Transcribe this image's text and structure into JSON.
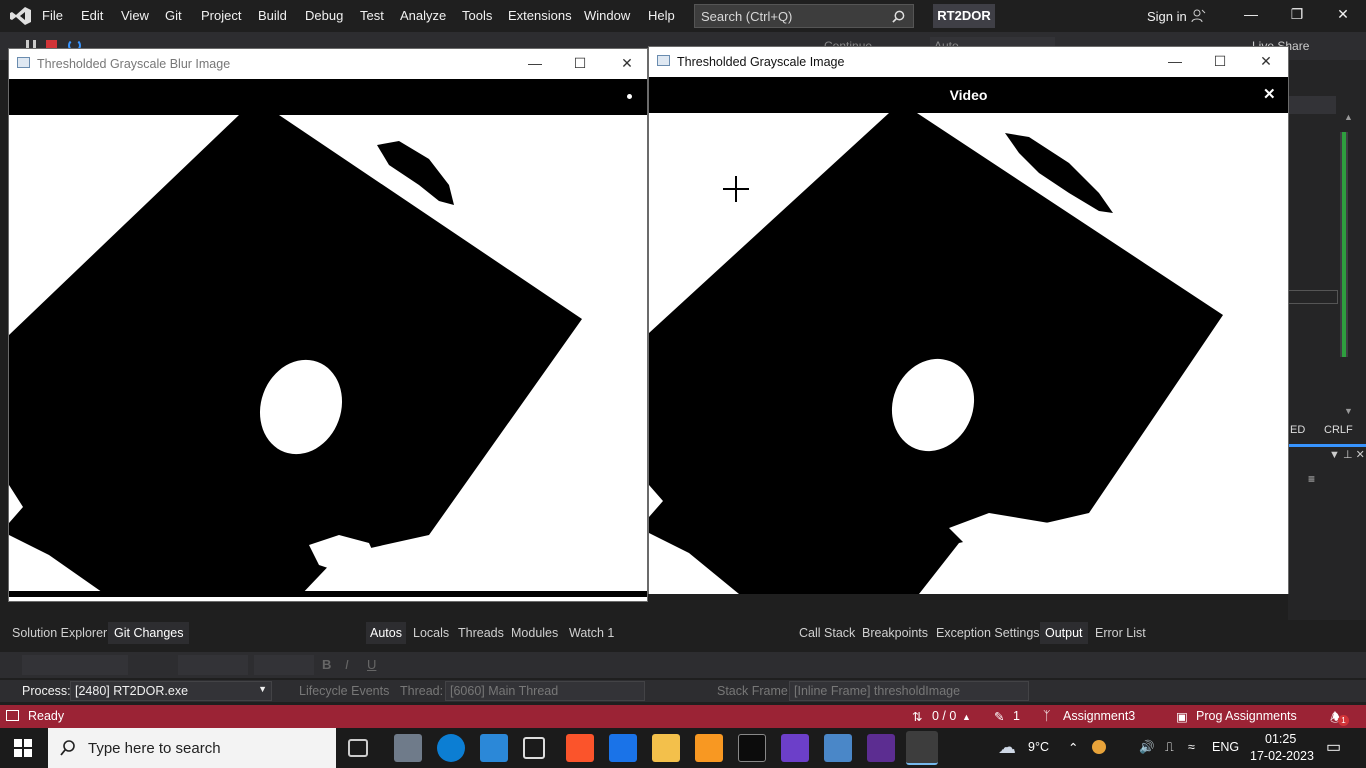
{
  "menu": {
    "items": [
      "File",
      "Edit",
      "View",
      "Git",
      "Project",
      "Build",
      "Debug",
      "Test",
      "Analyze",
      "Tools",
      "Extensions",
      "Window",
      "Help"
    ],
    "search_placeholder": "Search (Ctrl+Q)",
    "project_name": "RT2DOR",
    "sign_in": "Sign in",
    "toolbar_continue": "Continue",
    "toolbar_auto": "Auto",
    "live_share": "Live Share"
  },
  "window_blur": {
    "title": "Thresholded Grayscale Blur Image"
  },
  "window_gray": {
    "title": "Thresholded Grayscale Image",
    "overlay_title": "Video"
  },
  "right_pane": {
    "line_ending": "CRLF",
    "encoding_partial": "ED"
  },
  "bottom_panels": {
    "left_tabs": [
      "Solution Explorer",
      "Git Changes"
    ],
    "left_active": "Git Changes",
    "debug_tabs": [
      "Autos",
      "Locals",
      "Threads",
      "Modules",
      "Watch 1"
    ],
    "debug_active": "Autos",
    "output_tabs": [
      "Call Stack",
      "Breakpoints",
      "Exception Settings",
      "Output",
      "Error List"
    ],
    "output_active": "Output"
  },
  "debug_location": {
    "process_label": "Process:",
    "process_value": "[2480] RT2DOR.exe",
    "lifecycle_label": "Lifecycle Events",
    "thread_label": "Thread:",
    "thread_value": "[6060] Main Thread",
    "stack_label": "Stack Frame:",
    "stack_value": "[Inline Frame] thresholdImage"
  },
  "statusbar": {
    "state": "Ready",
    "changes": "0 / 0",
    "edits": "1",
    "branch": "Assignment3",
    "repo": "Prog Assignments",
    "notifications": "1",
    "color": "#9b2335"
  },
  "taskbar": {
    "search_placeholder": "Type here to search",
    "weather": "9°C",
    "language": "ENG",
    "time": "01:25",
    "date": "17-02-2023"
  }
}
